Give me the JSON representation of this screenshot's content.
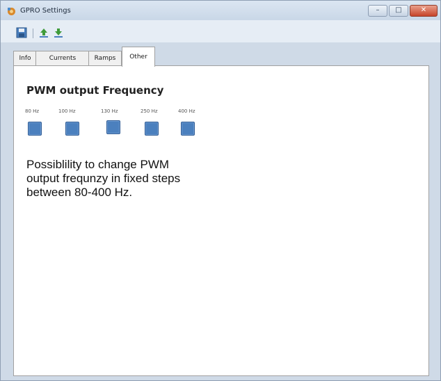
{
  "window": {
    "title": "GPRO Settings"
  },
  "tabs": [
    {
      "label": "Info"
    },
    {
      "label": "Currents"
    },
    {
      "label": "Ramps"
    },
    {
      "label": "Other"
    }
  ],
  "active_tab": "Other",
  "panel": {
    "heading": "PWM output Frequency",
    "frequencies": [
      {
        "label": "80 Hz"
      },
      {
        "label": "100 Hz"
      },
      {
        "label": "130 Hz"
      },
      {
        "label": "250 Hz"
      },
      {
        "label": "400 Hz"
      }
    ],
    "description_lines": [
      "Possiblility to change PWM",
      "output frequnzy in fixed steps",
      "between 80-400 Hz."
    ]
  },
  "icons": {
    "app": "gear-icon",
    "save": "save-icon",
    "upload": "upload-icon",
    "download": "download-icon"
  },
  "colors": {
    "checkbox_fill": "#4b80be",
    "window_frame": "#cfdae7",
    "close_button": "#c6442a"
  }
}
